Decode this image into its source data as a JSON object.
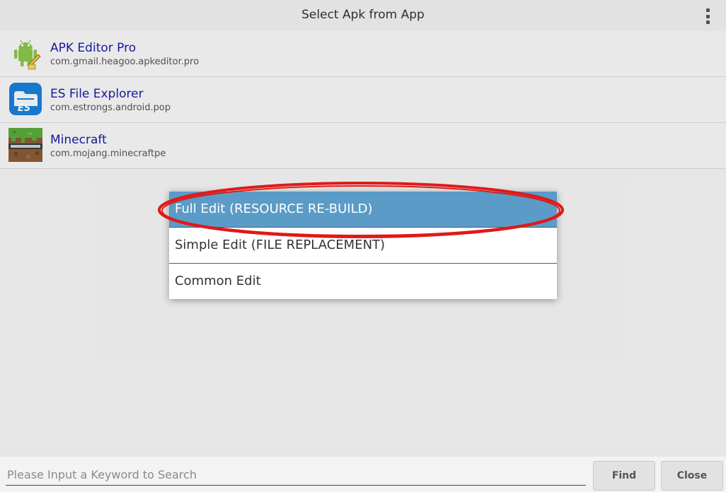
{
  "header": {
    "title": "Select Apk from App",
    "menu_icon": "overflow-menu-icon"
  },
  "apps": [
    {
      "name": "APK Editor Pro",
      "package": "com.gmail.heagoo.apkeditor.pro",
      "icon": "android-robot-icon"
    },
    {
      "name": "ES File Explorer",
      "package": "com.estrongs.android.pop",
      "icon": "es-file-explorer-icon"
    },
    {
      "name": "Minecraft",
      "package": "com.mojang.minecraftpe",
      "icon": "minecraft-grass-block-icon"
    }
  ],
  "dialog": {
    "options": [
      {
        "label": "Full Edit (RESOURCE RE-BUILD)",
        "selected": true
      },
      {
        "label": "Simple Edit (FILE REPLACEMENT)",
        "selected": false
      },
      {
        "label": "Common Edit",
        "selected": false
      }
    ]
  },
  "search": {
    "placeholder": "Please Input a Keyword to Search",
    "value": ""
  },
  "buttons": {
    "find": "Find",
    "close": "Close"
  },
  "colors": {
    "selected_option_bg": "#5b9bc7",
    "app_name": "#1a1aa6",
    "highlight_ring": "#e01919"
  }
}
